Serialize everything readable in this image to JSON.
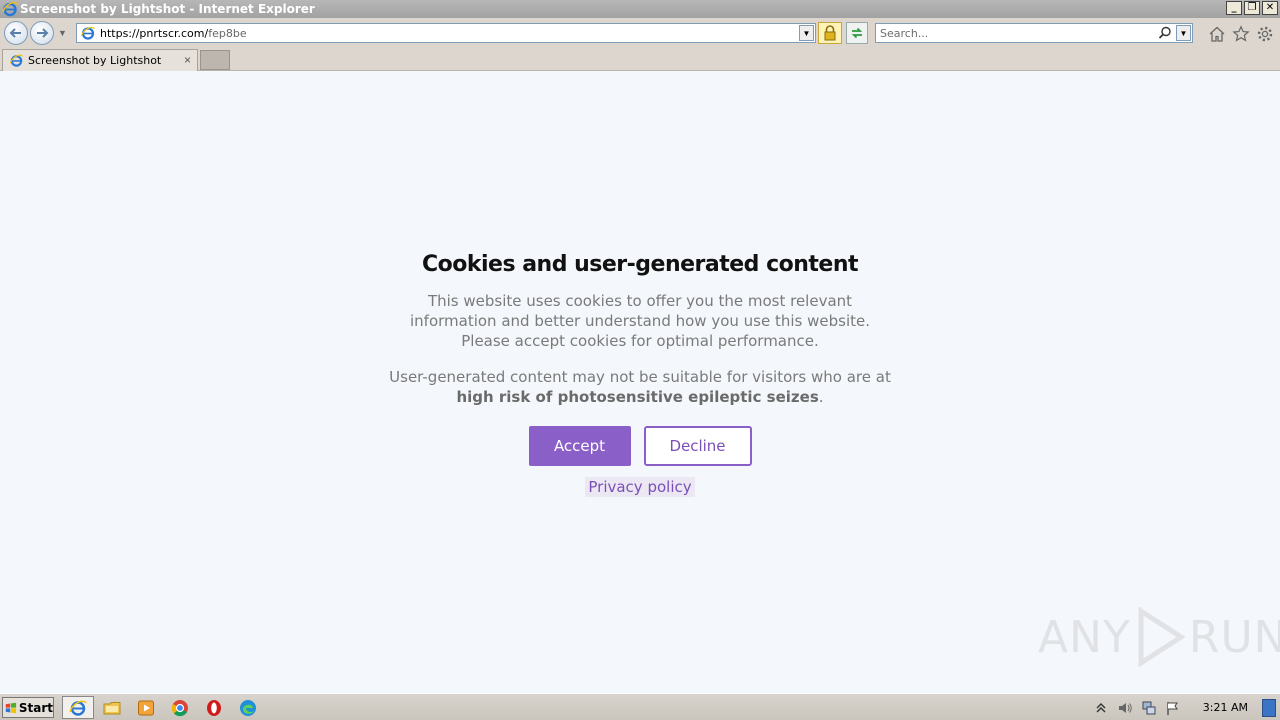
{
  "window": {
    "title": "Screenshot by Lightshot - Internet Explorer",
    "minimize_glyph": "_",
    "restore_glyph": "❐",
    "close_glyph": "✕"
  },
  "address_bar": {
    "url_host": "https://pnrtscr.com/",
    "url_path": "fep8be"
  },
  "search": {
    "placeholder": "Search..."
  },
  "tab": {
    "title": "Screenshot by Lightshot",
    "close_glyph": "×"
  },
  "consent": {
    "heading": "Cookies and user-generated content",
    "paragraph1_line1": "This website uses cookies to offer you the most relevant",
    "paragraph1_line2": "information and better understand how you use this website.",
    "paragraph1_line3": "Please accept cookies for optimal performance.",
    "paragraph2_line1": "User-generated content may not be suitable for visitors who are at",
    "paragraph2_bold": "high risk of photosensitive epileptic seizes",
    "paragraph2_end": ".",
    "accept_label": "Accept",
    "decline_label": "Decline",
    "privacy_label": "Privacy policy"
  },
  "watermark": {
    "left": "ANY",
    "right": "RUN"
  },
  "taskbar": {
    "start_label": "Start",
    "clock": "3:21 AM"
  },
  "colors": {
    "accent": "#8a5fc7",
    "page_bg": "#f4f7fb",
    "chrome_bg": "#dcd6cf"
  }
}
